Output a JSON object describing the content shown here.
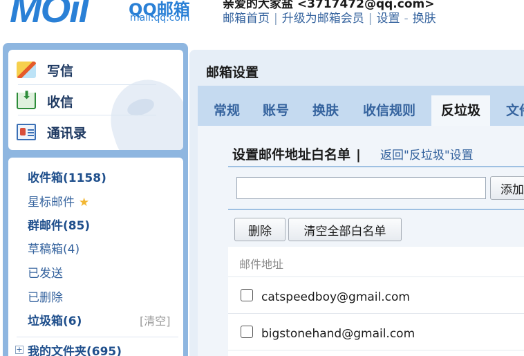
{
  "header": {
    "logo_text": "MOil",
    "brand": "QQ邮箱",
    "brand_url": "mail.qq.com",
    "greeting": "亲爱的大家盐 <3717472@qq.com>",
    "links": [
      "邮箱首页",
      "升级为邮箱会员",
      "设置",
      "换肤"
    ]
  },
  "sidebar": {
    "actions": [
      {
        "label": "写信",
        "icon": "write-icon"
      },
      {
        "label": "收信",
        "icon": "inbox-download-icon"
      },
      {
        "label": "通讯录",
        "icon": "contacts-icon"
      }
    ],
    "folders": [
      {
        "label": "收件箱(1158)",
        "bold": true
      },
      {
        "label": "星标邮件",
        "bold": false,
        "icon": "star-icon"
      },
      {
        "label": "群邮件(85)",
        "bold": true
      },
      {
        "label": "草稿箱(4)",
        "bold": false
      },
      {
        "label": "已发送",
        "bold": false
      },
      {
        "label": "已删除",
        "bold": false
      },
      {
        "label": "垃圾箱(6)",
        "bold": true,
        "action": "[清空]"
      }
    ],
    "my_folders": "我的文件夹(695)",
    "expand_symbol": "+"
  },
  "settings": {
    "title": "邮箱设置",
    "tabs": [
      "常规",
      "账号",
      "换肤",
      "收信规则",
      "反垃圾",
      "文件"
    ],
    "active_tab": "反垃圾",
    "heading": "设置邮件地址白名单",
    "heading_separator": "|",
    "back_link": "返回\"反垃圾\"设置",
    "input_value": "",
    "input_placeholder": "",
    "add_button": "添加",
    "delete_button": "删除",
    "clear_all_button": "清空全部白名单",
    "column_header": "邮件地址",
    "emails": [
      "catspeedboy@gmail.com",
      "bigstonehand@gmail.com"
    ]
  },
  "colors": {
    "accent": "#35639e",
    "sidebar_bg": "#8eb6e0",
    "tab_bar": "#c5daf0",
    "logo": "#2a80d6"
  }
}
